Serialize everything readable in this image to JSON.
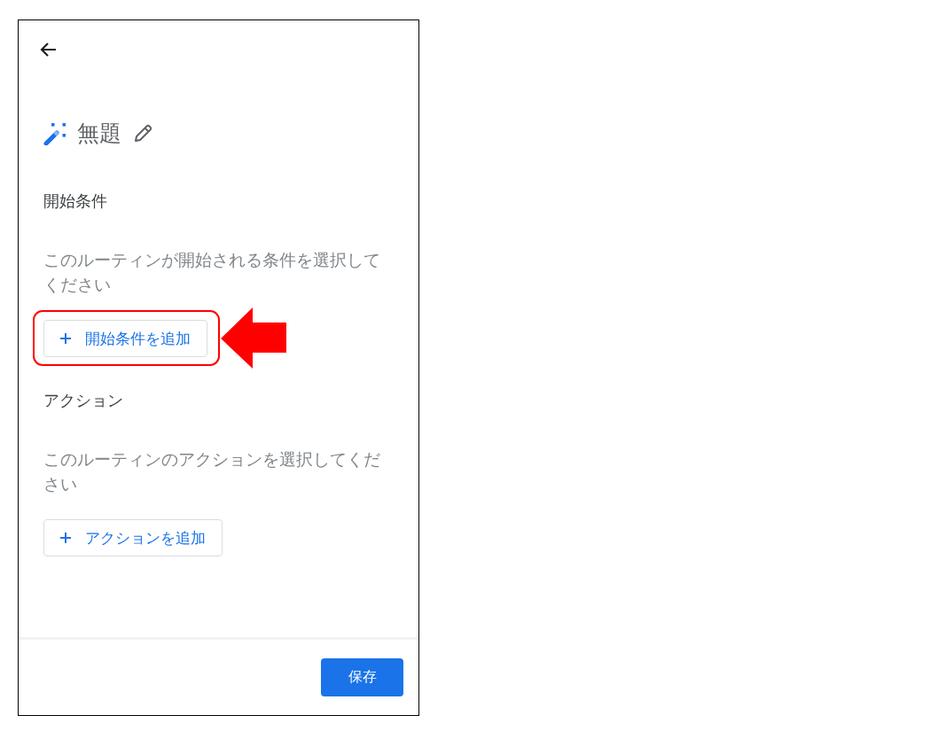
{
  "routine": {
    "title": "無題"
  },
  "sections": [
    {
      "heading": "開始条件",
      "description": "このルーティンが開始される条件を選択してください",
      "add_button": {
        "label": "開始条件を追加",
        "highlighted": true
      }
    },
    {
      "heading": "アクション",
      "description": "このルーティンのアクションを選択してください",
      "add_button": {
        "label": "アクションを追加",
        "highlighted": false
      }
    }
  ],
  "footer": {
    "save_button": "保存"
  }
}
